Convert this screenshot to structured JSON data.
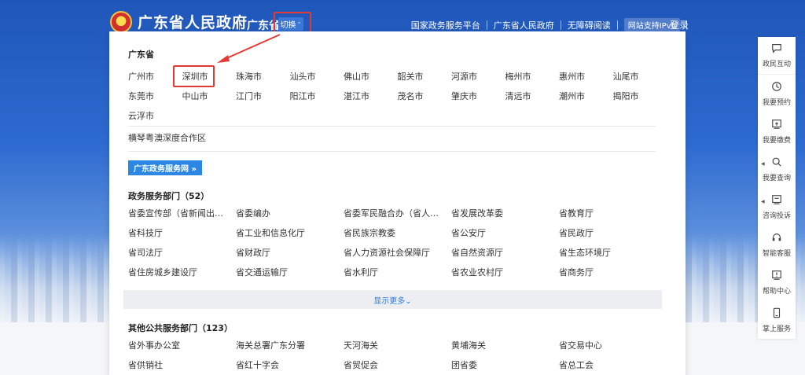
{
  "header": {
    "site_title": "广东省人民政府",
    "region": "广东省",
    "switch_label": "切换",
    "links": [
      "国家政务服务平台",
      "广东省人民政府",
      "无障碍阅读"
    ],
    "ipv6": "网站支持IPv6",
    "login": "登录"
  },
  "panel": {
    "province": "广东省",
    "cities": [
      "广州市",
      "深圳市",
      "珠海市",
      "汕头市",
      "佛山市",
      "韶关市",
      "河源市",
      "梅州市",
      "惠州市",
      "汕尾市",
      "东莞市",
      "中山市",
      "江门市",
      "阳江市",
      "湛江市",
      "茂名市",
      "肇庆市",
      "清远市",
      "潮州市",
      "揭阳市",
      "云浮市"
    ],
    "highlighted_city": "深圳市",
    "cooperation_zone": "横琴粤澳深度合作区",
    "gd_button": "广东政务服务网 »",
    "gov_section_title": "政务服务部门（52）",
    "gov_depts": [
      "省委宣传部（省新闻出版...",
      "省委编办",
      "省委军民融合办（省人防...",
      "省发展改革委",
      "省教育厅",
      "省科技厅",
      "省工业和信息化厅",
      "省民族宗教委",
      "省公安厅",
      "省民政厅",
      "省司法厅",
      "省财政厅",
      "省人力资源社会保障厅",
      "省自然资源厅",
      "省生态环境厅",
      "省住房城乡建设厅",
      "省交通运输厅",
      "省水利厅",
      "省农业农村厅",
      "省商务厅"
    ],
    "show_more": "显示更多⌄",
    "other_section_title": "其他公共服务部门（123）",
    "other_depts": [
      "省外事办公室",
      "海关总署广东分署",
      "天河海关",
      "黄埔海关",
      "省交易中心",
      "省供销社",
      "省红十字会",
      "省贸促会",
      "团省委",
      "省总工会"
    ]
  },
  "sidebar": {
    "items": [
      {
        "label": "政民互动",
        "icon": "chat-icon"
      },
      {
        "label": "我要预约",
        "icon": "clock-icon"
      },
      {
        "label": "我要缴费",
        "icon": "payment-icon"
      },
      {
        "label": "我要查询",
        "icon": "search-icon"
      },
      {
        "label": "咨询投诉",
        "icon": "message-icon"
      },
      {
        "label": "智能客服",
        "icon": "headset-icon"
      },
      {
        "label": "帮助中心",
        "icon": "help-icon"
      },
      {
        "label": "掌上服务",
        "icon": "mobile-icon"
      }
    ]
  },
  "colors": {
    "accent": "#2b87e3",
    "highlight_border": "#e53935",
    "header_blue": "#1f56b9"
  }
}
